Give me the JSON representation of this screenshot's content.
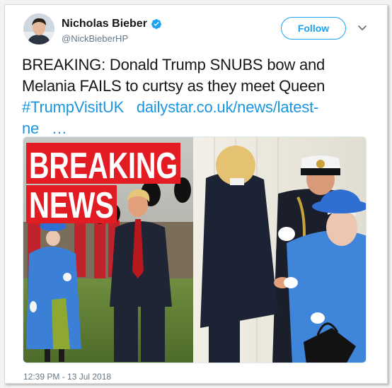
{
  "user": {
    "display_name": "Nicholas Bieber",
    "handle": "@NickBieberHP"
  },
  "actions": {
    "follow_label": "Follow"
  },
  "tweet": {
    "text": "BREAKING: Donald Trump SNUBS bow and Melania FAILS to curtsy as they meet Queen",
    "hashtag": "#TrumpVisitUK",
    "link_part1": "dailystar.co.uk/news/latest-",
    "link_part2": "ne",
    "ellipsis": "…",
    "timestamp": "12:39 PM - 13 Jul 2018"
  },
  "media": {
    "banner_line1": "BREAKING",
    "banner_line2": "NEWS"
  },
  "colors": {
    "accent": "#1da1f2",
    "link": "#1b95e0",
    "banner_red": "#e31b23",
    "queen_blue": "#3c7fd6"
  },
  "icons": [
    "verified-badge-icon",
    "chevron-down-icon"
  ]
}
